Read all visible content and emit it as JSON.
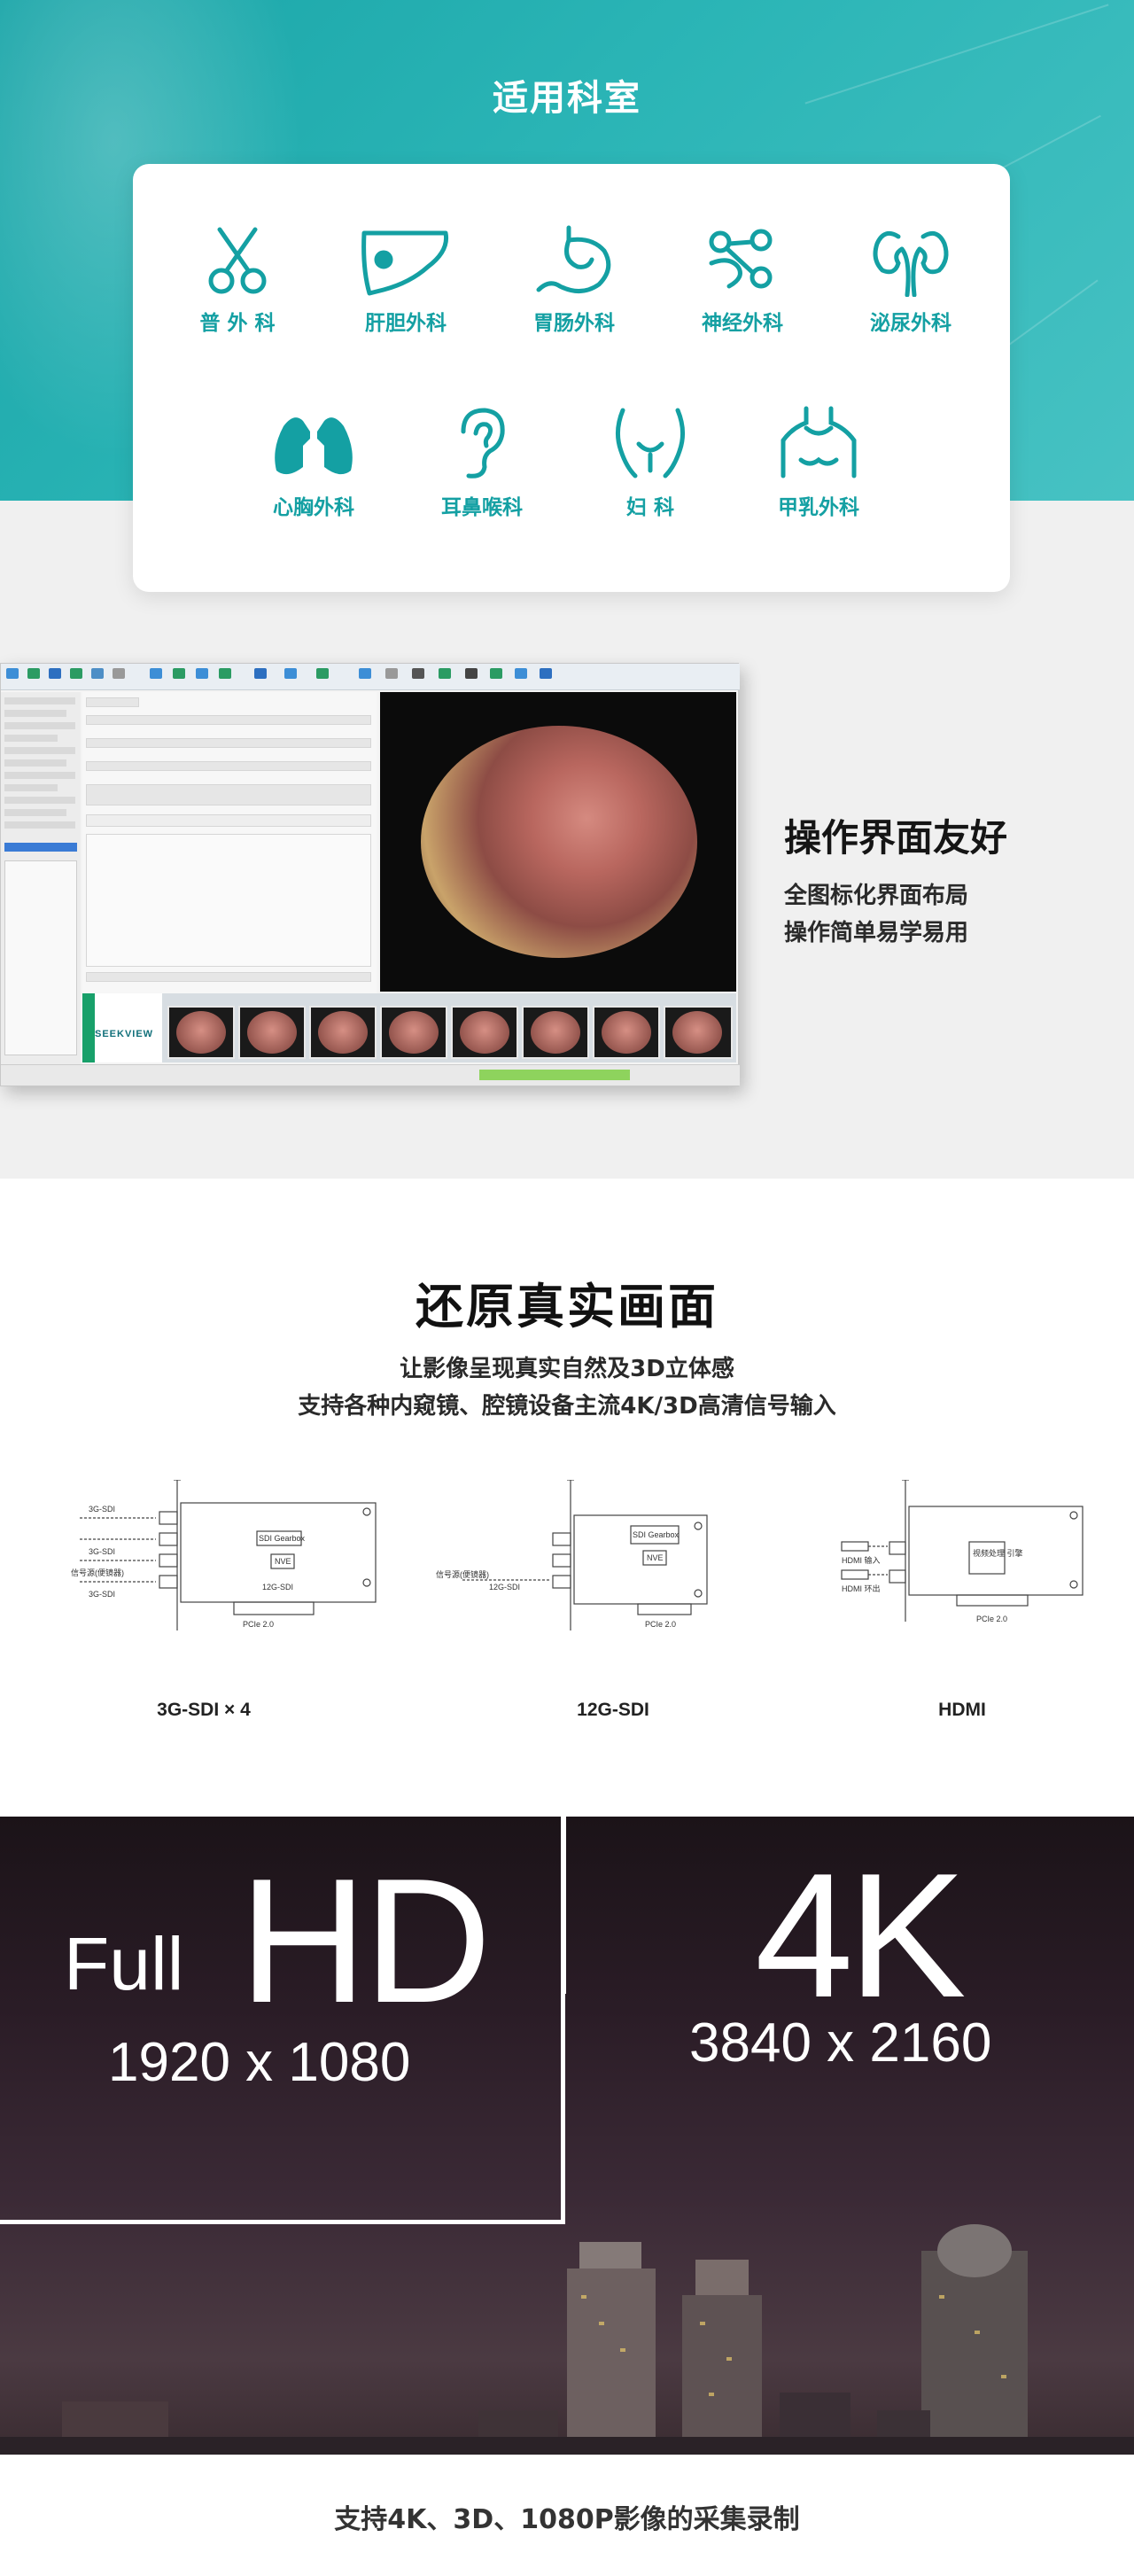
{
  "departments": {
    "title": "适用科室",
    "items": [
      {
        "label": "普 外 科",
        "icon": "scissors-icon"
      },
      {
        "label": "肝胆外科",
        "icon": "liver-icon"
      },
      {
        "label": "胃肠外科",
        "icon": "stomach-icon"
      },
      {
        "label": "神经外科",
        "icon": "neuron-icon"
      },
      {
        "label": "泌尿外科",
        "icon": "kidneys-icon"
      },
      {
        "label": "心胸外科",
        "icon": "lungs-icon"
      },
      {
        "label": "耳鼻喉科",
        "icon": "ear-icon"
      },
      {
        "label": "妇    科",
        "icon": "pelvis-icon"
      },
      {
        "label": "甲乳外科",
        "icon": "neck-chest-icon"
      }
    ],
    "accent_color": "#14a0a3"
  },
  "interface": {
    "title": "操作界面友好",
    "lines": [
      "全图标化界面布局",
      "操作简单易学易用"
    ],
    "screenshot_logo": "SEEKVIEW"
  },
  "capture": {
    "title": "还原真实画面",
    "subtitle_1": "让影像呈现真实自然及3D立体感",
    "subtitle_2": "支持各种内窥镜、腔镜设备主流4K/3D高清信号输入",
    "cards": [
      {
        "label": "3G-SDI × 4",
        "icon": "pcie-card-3g-sdi-icon"
      },
      {
        "label": "12G-SDI",
        "icon": "pcie-card-12g-sdi-icon"
      },
      {
        "label": "HDMI",
        "icon": "pcie-card-hdmi-icon"
      }
    ],
    "diagram_text": {
      "sdi3g": "3G-SDI",
      "sdi12g": "12G-SDI",
      "gearbox": "SDI Gearbox",
      "nvc": "NVE",
      "pcie": "PCIe 2.0",
      "hdmi_in": "HDMI 输入",
      "hdmi_out": "HDMI 环出",
      "signal_src": "信号源(便镜器)",
      "codec": "视频处理\n引擎"
    }
  },
  "resolution": {
    "full": "Full",
    "hd": "HD",
    "fhd_res": "1920 x 1080",
    "uhd": "4K",
    "uhd_res": "3840 x 2160"
  },
  "footer": {
    "caption": "支持4K、3D、1080P影像的采集录制"
  }
}
